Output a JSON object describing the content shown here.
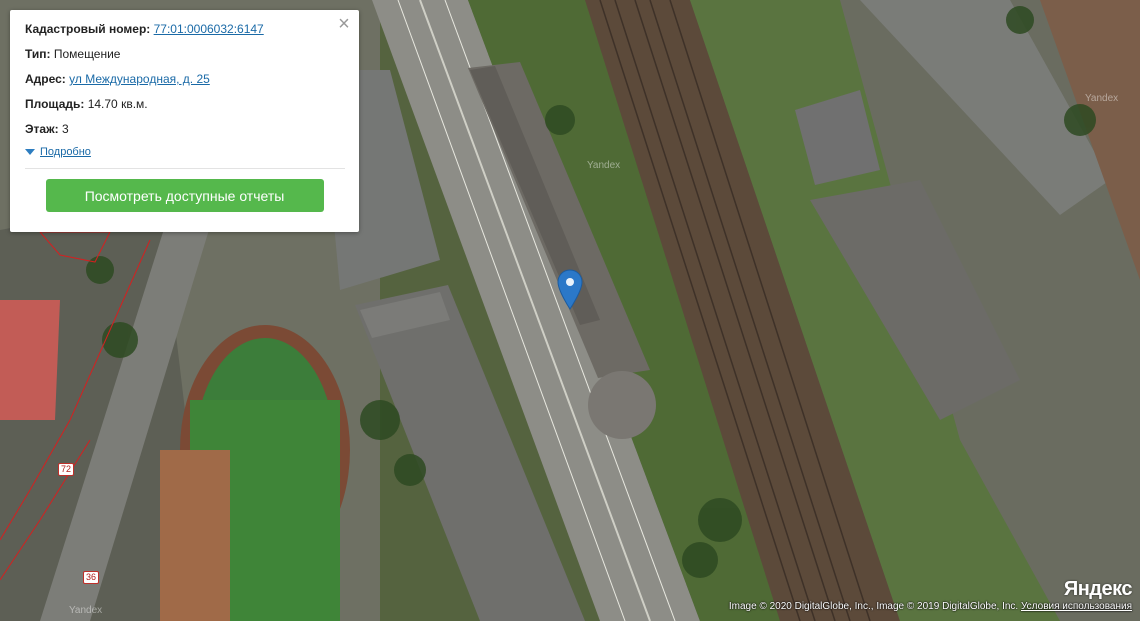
{
  "card": {
    "cadastral_label": "Кадастровый номер:",
    "cadastral_value": "77:01:0006032:6147",
    "type_label": "Тип:",
    "type_value": "Помещение",
    "address_label": "Адрес:",
    "address_value": "ул Международная, д. 25",
    "area_label": "Площадь:",
    "area_value": "14.70 кв.м.",
    "floor_label": "Этаж:",
    "floor_value": "3",
    "more_label": "Подробно",
    "close_icon": "×",
    "reports_button": "Посмотреть доступные отчеты"
  },
  "map": {
    "watermarks": [
      "Yandex",
      "Yandex",
      "Yandex"
    ],
    "road_labels": [
      "72",
      "36"
    ],
    "attribution_text": "Image © 2020 DigitalGlobe, Inc., Image © 2019 DigitalGlobe, Inc. ",
    "terms_link": "Условия использования",
    "logo": "Яндекс",
    "marker_icon": "map-pin-icon",
    "colors": {
      "marker": "#2b78c8",
      "button": "#55b84c",
      "link": "#1a6aa7",
      "cadastral_outline": "#d42020"
    }
  }
}
